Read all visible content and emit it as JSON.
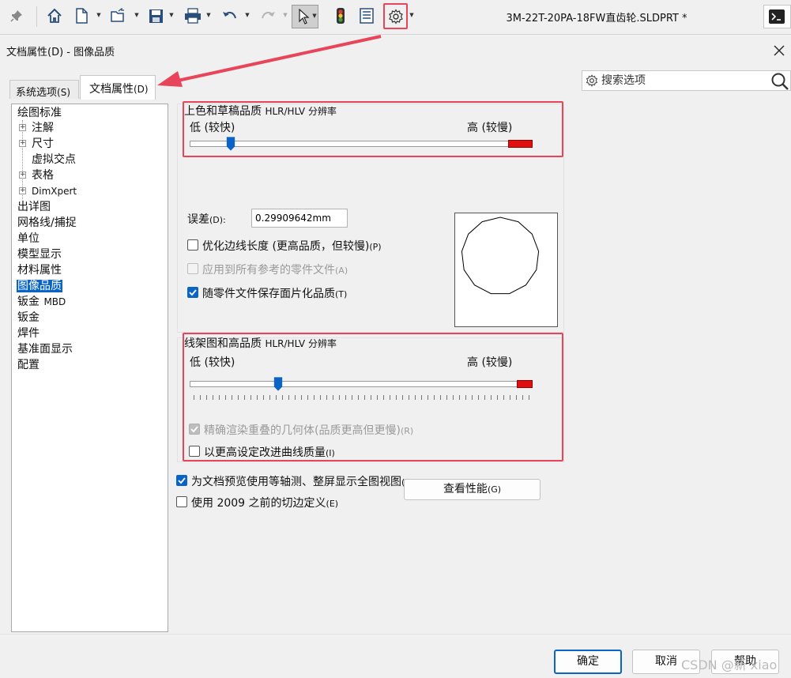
{
  "toolbar": {
    "doc_title": "3M-22T-20PA-18FW直齿轮.SLDPRT *",
    "icons": [
      "pin-icon",
      "home-icon",
      "new-doc-icon",
      "open-icon",
      "save-icon",
      "print-icon",
      "undo-icon",
      "redo-icon",
      "select-pointer-icon",
      "traffic-light-icon",
      "file-properties-icon",
      "gear-icon",
      "terminal-icon"
    ]
  },
  "dialog": {
    "title": "文档属性(D) - 图像品质",
    "tabs": [
      {
        "main": "系统选项",
        "key": "(S)"
      },
      {
        "main": "文档属性",
        "key": "(D)"
      }
    ],
    "search_placeholder": "搜索选项"
  },
  "tree": {
    "items": [
      "绘图标准",
      "注解",
      "尺寸",
      "虚拟交点",
      "表格",
      "DimXpert",
      "出详图",
      "网格线/捕捉",
      "单位",
      "模型显示",
      "材料属性",
      "图像品质",
      "钣金",
      "MBD",
      "钣金",
      "焊件",
      "基准面显示",
      "配置"
    ],
    "selected": "图像品质"
  },
  "shaded": {
    "title_main": "上色和草稿品质",
    "title_suffix": "HLR/HLV 分辨率",
    "low": "低 (较快)",
    "high": "高 (较慢)",
    "slider_value": 0.13,
    "tolerance_label": "误差",
    "tolerance_key": "(D):",
    "tolerance_value": "0.29909642mm",
    "options": [
      {
        "label": "优化边线长度 (更高品质，但较慢)",
        "key": "(P)",
        "checked": false,
        "enabled": true
      },
      {
        "label": "应用到所有参考的零件文件",
        "key": "(A)",
        "checked": false,
        "enabled": false
      },
      {
        "label": "随零件文件保存面片化品质",
        "key": "(T)",
        "checked": true,
        "enabled": true
      }
    ]
  },
  "wireframe": {
    "title_main": "线架图和高品质",
    "title_suffix": "HLR/HLV 分辨率",
    "low": "低 (较快)",
    "high": "高 (较慢)",
    "slider_value": 0.25,
    "options": [
      {
        "label": "精确渲染重叠的几何体(品质更高但更慢)",
        "key": "(R)",
        "checked": true,
        "enabled": false
      },
      {
        "label": "以更高设定改进曲线质量",
        "key": "(I)",
        "checked": false,
        "enabled": true
      }
    ]
  },
  "extra_options": [
    {
      "label": "为文档预览使用等轴测、整屏显示全图视图",
      "key": "(Z)",
      "checked": true
    },
    {
      "label": "使用 2009 之前的切边定义",
      "key": "(E)",
      "checked": false
    }
  ],
  "performance_button": {
    "label": "查看性能",
    "key": "(G)"
  },
  "buttons": {
    "ok": "确定",
    "cancel": "取消",
    "help": "帮助"
  },
  "watermark": "CSDN @新 xiao",
  "colors": {
    "accent": "#0a64c8",
    "highlight": "#e8455a",
    "slider_max": "#e01010"
  }
}
